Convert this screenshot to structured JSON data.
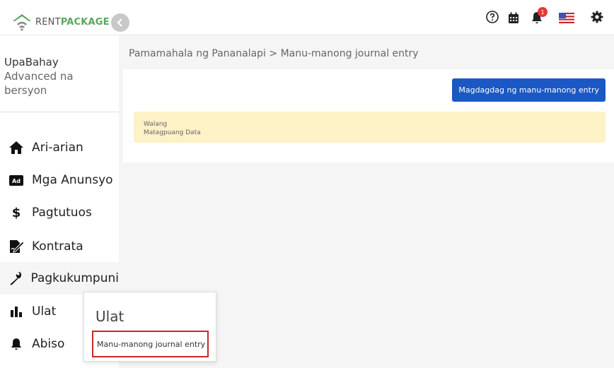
{
  "header": {
    "logo_prefix": "RENT",
    "logo_suffix": "PACKAGE",
    "notification_count": "1",
    "icons": [
      "help-icon",
      "calendar-icon",
      "bell-icon",
      "us-flag-icon",
      "gear-icon"
    ]
  },
  "sidebar": {
    "user_name": "UpaBahay",
    "version": "Advanced na bersyon",
    "items": [
      {
        "label": "Ari-arian",
        "icon": "home-icon"
      },
      {
        "label": "Mga Anunsyo",
        "icon": "ad-icon"
      },
      {
        "label": "Pagtutuos",
        "icon": "dollar-icon"
      },
      {
        "label": "Kontrata",
        "icon": "contract-icon"
      },
      {
        "label": "Pagkukumpuni",
        "icon": "wrench-icon"
      },
      {
        "label": "Ulat",
        "icon": "bar-chart-icon"
      },
      {
        "label": "Abiso",
        "icon": "bell-icon"
      }
    ]
  },
  "main": {
    "breadcrumb": "Pamamahala ng Pananalapi > Manu-manong journal entry",
    "add_button": "Magdagdag ng manu-manong entry",
    "empty_line1": "Walang",
    "empty_line2": "Matagpuang Data"
  },
  "popup": {
    "title": "Ulat",
    "link": "Manu-manong journal entry"
  },
  "colors": {
    "brand_green": "#58a85b",
    "primary_button": "#1b58c4",
    "empty_bg": "#fdf1c6",
    "highlight_border": "#c62828",
    "badge": "#e53935"
  }
}
